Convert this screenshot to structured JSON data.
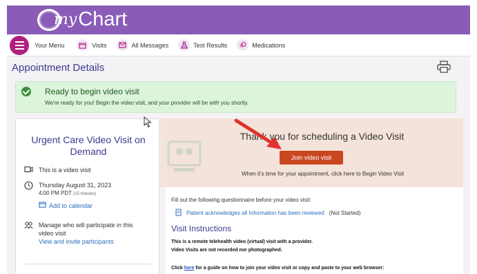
{
  "app": {
    "logo_my": "my",
    "logo_chart": "Chart"
  },
  "menubar": {
    "menu_label": "Your Menu",
    "items": [
      {
        "label": "Visits",
        "icon": "calendar-icon"
      },
      {
        "label": "All Messages",
        "icon": "envelope-icon"
      },
      {
        "label": "Test Results",
        "icon": "flask-icon"
      },
      {
        "label": "Medications",
        "icon": "pill-icon"
      }
    ]
  },
  "page": {
    "title": "Appointment Details"
  },
  "banner": {
    "title": "Ready to begin video visit",
    "text": "We're ready for you! Begin the video visit, and your provider will be with you shortly."
  },
  "appointment": {
    "title": "Urgent Care Video Visit on Demand",
    "video_text": "This is a video visit",
    "date": "Thursday August 31, 2023",
    "time": "4:00 PM PDT",
    "duration": "(15 minutes)",
    "add_calendar": "Add to calendar",
    "manage_text": "Manage who will participate in this video visit",
    "invite_link": "View and invite participants"
  },
  "video": {
    "thanks": "Thank you for scheduling a Video Visit",
    "join_button": "Join video visit",
    "when_text": "When it's time for your appointment, click here to Begin Video Visit"
  },
  "questionnaire": {
    "intro": "Fill out the following questionnaire before your video visit:",
    "item": "Patient acknowledges all Information has been reviewed",
    "status": "(Not Started)"
  },
  "instructions": {
    "title": "Visit Instructions",
    "line1": "This is a remote telehealth video (virtual) visit with a provider.",
    "line2": "Video Visits are not recorded nor photographed.",
    "click_prefix": "Click ",
    "click_link": "here",
    "click_suffix": " for a guide on how to join your video visit or copy and paste to your web browser:"
  },
  "colors": {
    "header": "#8a5cb8",
    "accent": "#3b3b8e",
    "join": "#c9461f",
    "banner": "#dcf3dc",
    "arrow": "#e0322e"
  }
}
